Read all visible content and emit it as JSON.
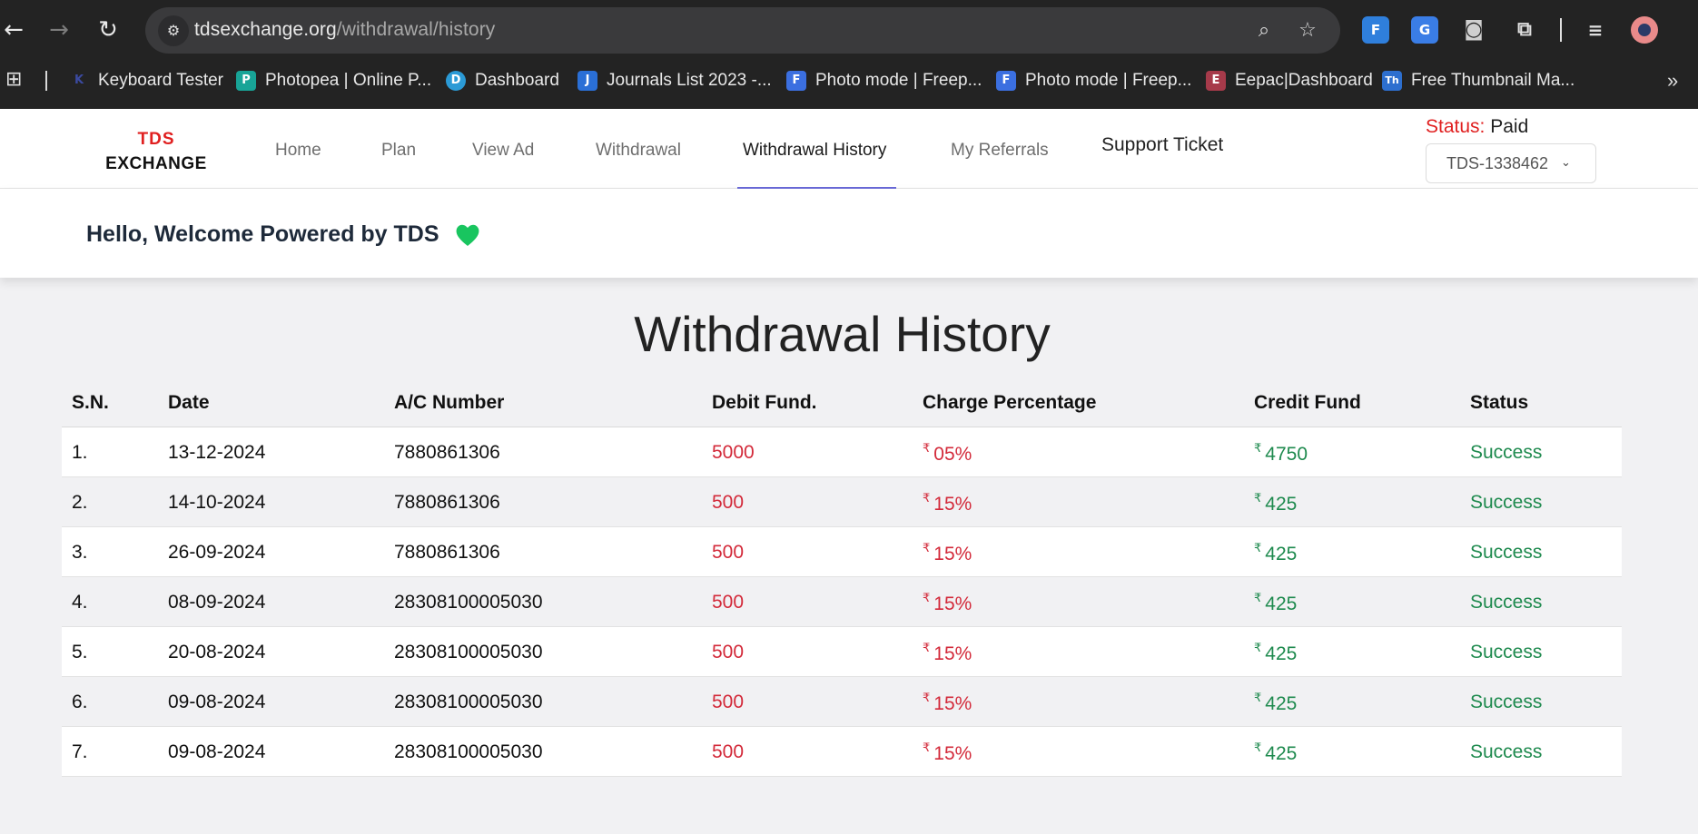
{
  "browser": {
    "url_host": "tdsexchange.org",
    "url_path": "/withdrawal/history",
    "bookmarks": [
      {
        "label": "Keyboard Tester",
        "icon": "keyboard-tester-favicon",
        "color": "#1f2a6b",
        "glyph": "K"
      },
      {
        "label": "Photopea | Online P...",
        "icon": "photopea-favicon",
        "color": "#18a497",
        "glyph": "P"
      },
      {
        "label": "Dashboard",
        "icon": "dashboard-favicon",
        "color": "#2b9ad6",
        "glyph": "D"
      },
      {
        "label": "Journals List 2023 -...",
        "icon": "journals-favicon",
        "color": "#2a6fd6",
        "glyph": "J"
      },
      {
        "label": "Photo mode | Freep...",
        "icon": "freepik-favicon",
        "color": "#3b6fe0",
        "glyph": "F"
      },
      {
        "label": "Photo mode | Freep...",
        "icon": "freepik-favicon",
        "color": "#3b6fe0",
        "glyph": "F"
      },
      {
        "label": "Eepac|Dashboard",
        "icon": "eepac-favicon",
        "color": "#a63a4a",
        "glyph": "E"
      },
      {
        "label": "Free Thumbnail Ma...",
        "icon": "thumbnail-favicon",
        "color": "#2d6fcf",
        "glyph": "Th"
      }
    ]
  },
  "header": {
    "logo_line1": "TDS",
    "logo_line2": "EXCHANGE",
    "nav": [
      {
        "label": "Home"
      },
      {
        "label": "Plan"
      },
      {
        "label": "View Ad"
      },
      {
        "label": "Withdrawal"
      },
      {
        "label": "Withdrawal History",
        "active": true
      },
      {
        "label": "My Referrals"
      }
    ],
    "support": "Support Ticket",
    "status_label": "Status:",
    "status_value": "Paid",
    "account_id": "TDS-1338462"
  },
  "welcome": {
    "text": "Hello, Welcome Powered by TDS",
    "icon": "green-heart-icon"
  },
  "main": {
    "title": "Withdrawal History",
    "columns": [
      "S.N.",
      "Date",
      "A/C Number",
      "Debit Fund.",
      "Charge Percentage",
      "Credit Fund",
      "Status"
    ],
    "currency_symbol": "₹",
    "rows": [
      {
        "sn": "1.",
        "date": "13-12-2024",
        "ac": "7880861306",
        "debit": "5000",
        "charge": "05%",
        "credit": "4750",
        "status": "Success"
      },
      {
        "sn": "2.",
        "date": "14-10-2024",
        "ac": "7880861306",
        "debit": "500",
        "charge": "15%",
        "credit": "425",
        "status": "Success"
      },
      {
        "sn": "3.",
        "date": "26-09-2024",
        "ac": "7880861306",
        "debit": "500",
        "charge": "15%",
        "credit": "425",
        "status": "Success"
      },
      {
        "sn": "4.",
        "date": "08-09-2024",
        "ac": "28308100005030",
        "debit": "500",
        "charge": "15%",
        "credit": "425",
        "status": "Success"
      },
      {
        "sn": "5.",
        "date": "20-08-2024",
        "ac": "28308100005030",
        "debit": "500",
        "charge": "15%",
        "credit": "425",
        "status": "Success"
      },
      {
        "sn": "6.",
        "date": "09-08-2024",
        "ac": "28308100005030",
        "debit": "500",
        "charge": "15%",
        "credit": "425",
        "status": "Success"
      },
      {
        "sn": "7.",
        "date": "09-08-2024",
        "ac": "28308100005030",
        "debit": "500",
        "charge": "15%",
        "credit": "425",
        "status": "Success"
      }
    ]
  },
  "colors": {
    "brand_red": "#e02020",
    "debit_red": "#d32a3a",
    "success_green": "#1e8a4e",
    "nav_underline": "#6a6ad8"
  }
}
